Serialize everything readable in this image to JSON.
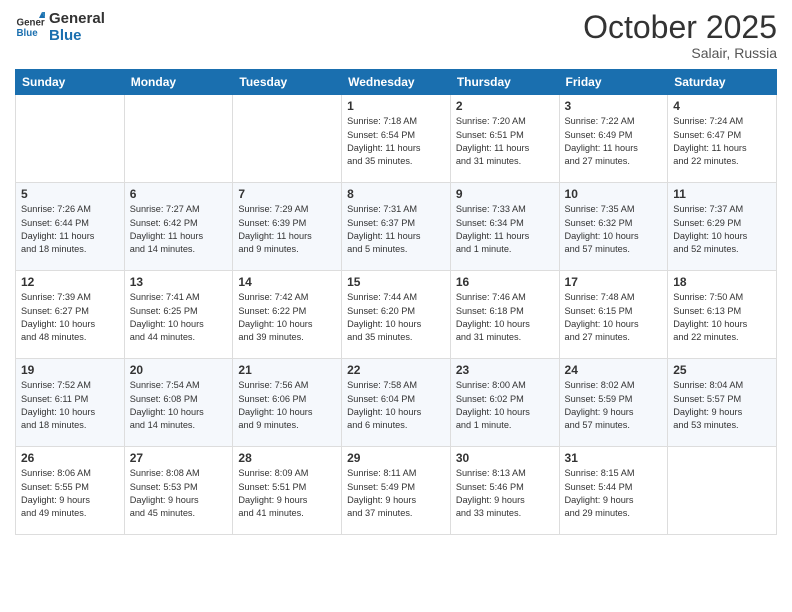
{
  "logo": {
    "line1": "General",
    "line2": "Blue"
  },
  "title": "October 2025",
  "location": "Salair, Russia",
  "days_of_week": [
    "Sunday",
    "Monday",
    "Tuesday",
    "Wednesday",
    "Thursday",
    "Friday",
    "Saturday"
  ],
  "weeks": [
    [
      {
        "num": "",
        "info": ""
      },
      {
        "num": "",
        "info": ""
      },
      {
        "num": "",
        "info": ""
      },
      {
        "num": "1",
        "info": "Sunrise: 7:18 AM\nSunset: 6:54 PM\nDaylight: 11 hours\nand 35 minutes."
      },
      {
        "num": "2",
        "info": "Sunrise: 7:20 AM\nSunset: 6:51 PM\nDaylight: 11 hours\nand 31 minutes."
      },
      {
        "num": "3",
        "info": "Sunrise: 7:22 AM\nSunset: 6:49 PM\nDaylight: 11 hours\nand 27 minutes."
      },
      {
        "num": "4",
        "info": "Sunrise: 7:24 AM\nSunset: 6:47 PM\nDaylight: 11 hours\nand 22 minutes."
      }
    ],
    [
      {
        "num": "5",
        "info": "Sunrise: 7:26 AM\nSunset: 6:44 PM\nDaylight: 11 hours\nand 18 minutes."
      },
      {
        "num": "6",
        "info": "Sunrise: 7:27 AM\nSunset: 6:42 PM\nDaylight: 11 hours\nand 14 minutes."
      },
      {
        "num": "7",
        "info": "Sunrise: 7:29 AM\nSunset: 6:39 PM\nDaylight: 11 hours\nand 9 minutes."
      },
      {
        "num": "8",
        "info": "Sunrise: 7:31 AM\nSunset: 6:37 PM\nDaylight: 11 hours\nand 5 minutes."
      },
      {
        "num": "9",
        "info": "Sunrise: 7:33 AM\nSunset: 6:34 PM\nDaylight: 11 hours\nand 1 minute."
      },
      {
        "num": "10",
        "info": "Sunrise: 7:35 AM\nSunset: 6:32 PM\nDaylight: 10 hours\nand 57 minutes."
      },
      {
        "num": "11",
        "info": "Sunrise: 7:37 AM\nSunset: 6:29 PM\nDaylight: 10 hours\nand 52 minutes."
      }
    ],
    [
      {
        "num": "12",
        "info": "Sunrise: 7:39 AM\nSunset: 6:27 PM\nDaylight: 10 hours\nand 48 minutes."
      },
      {
        "num": "13",
        "info": "Sunrise: 7:41 AM\nSunset: 6:25 PM\nDaylight: 10 hours\nand 44 minutes."
      },
      {
        "num": "14",
        "info": "Sunrise: 7:42 AM\nSunset: 6:22 PM\nDaylight: 10 hours\nand 39 minutes."
      },
      {
        "num": "15",
        "info": "Sunrise: 7:44 AM\nSunset: 6:20 PM\nDaylight: 10 hours\nand 35 minutes."
      },
      {
        "num": "16",
        "info": "Sunrise: 7:46 AM\nSunset: 6:18 PM\nDaylight: 10 hours\nand 31 minutes."
      },
      {
        "num": "17",
        "info": "Sunrise: 7:48 AM\nSunset: 6:15 PM\nDaylight: 10 hours\nand 27 minutes."
      },
      {
        "num": "18",
        "info": "Sunrise: 7:50 AM\nSunset: 6:13 PM\nDaylight: 10 hours\nand 22 minutes."
      }
    ],
    [
      {
        "num": "19",
        "info": "Sunrise: 7:52 AM\nSunset: 6:11 PM\nDaylight: 10 hours\nand 18 minutes."
      },
      {
        "num": "20",
        "info": "Sunrise: 7:54 AM\nSunset: 6:08 PM\nDaylight: 10 hours\nand 14 minutes."
      },
      {
        "num": "21",
        "info": "Sunrise: 7:56 AM\nSunset: 6:06 PM\nDaylight: 10 hours\nand 9 minutes."
      },
      {
        "num": "22",
        "info": "Sunrise: 7:58 AM\nSunset: 6:04 PM\nDaylight: 10 hours\nand 6 minutes."
      },
      {
        "num": "23",
        "info": "Sunrise: 8:00 AM\nSunset: 6:02 PM\nDaylight: 10 hours\nand 1 minute."
      },
      {
        "num": "24",
        "info": "Sunrise: 8:02 AM\nSunset: 5:59 PM\nDaylight: 9 hours\nand 57 minutes."
      },
      {
        "num": "25",
        "info": "Sunrise: 8:04 AM\nSunset: 5:57 PM\nDaylight: 9 hours\nand 53 minutes."
      }
    ],
    [
      {
        "num": "26",
        "info": "Sunrise: 8:06 AM\nSunset: 5:55 PM\nDaylight: 9 hours\nand 49 minutes."
      },
      {
        "num": "27",
        "info": "Sunrise: 8:08 AM\nSunset: 5:53 PM\nDaylight: 9 hours\nand 45 minutes."
      },
      {
        "num": "28",
        "info": "Sunrise: 8:09 AM\nSunset: 5:51 PM\nDaylight: 9 hours\nand 41 minutes."
      },
      {
        "num": "29",
        "info": "Sunrise: 8:11 AM\nSunset: 5:49 PM\nDaylight: 9 hours\nand 37 minutes."
      },
      {
        "num": "30",
        "info": "Sunrise: 8:13 AM\nSunset: 5:46 PM\nDaylight: 9 hours\nand 33 minutes."
      },
      {
        "num": "31",
        "info": "Sunrise: 8:15 AM\nSunset: 5:44 PM\nDaylight: 9 hours\nand 29 minutes."
      },
      {
        "num": "",
        "info": ""
      }
    ]
  ]
}
